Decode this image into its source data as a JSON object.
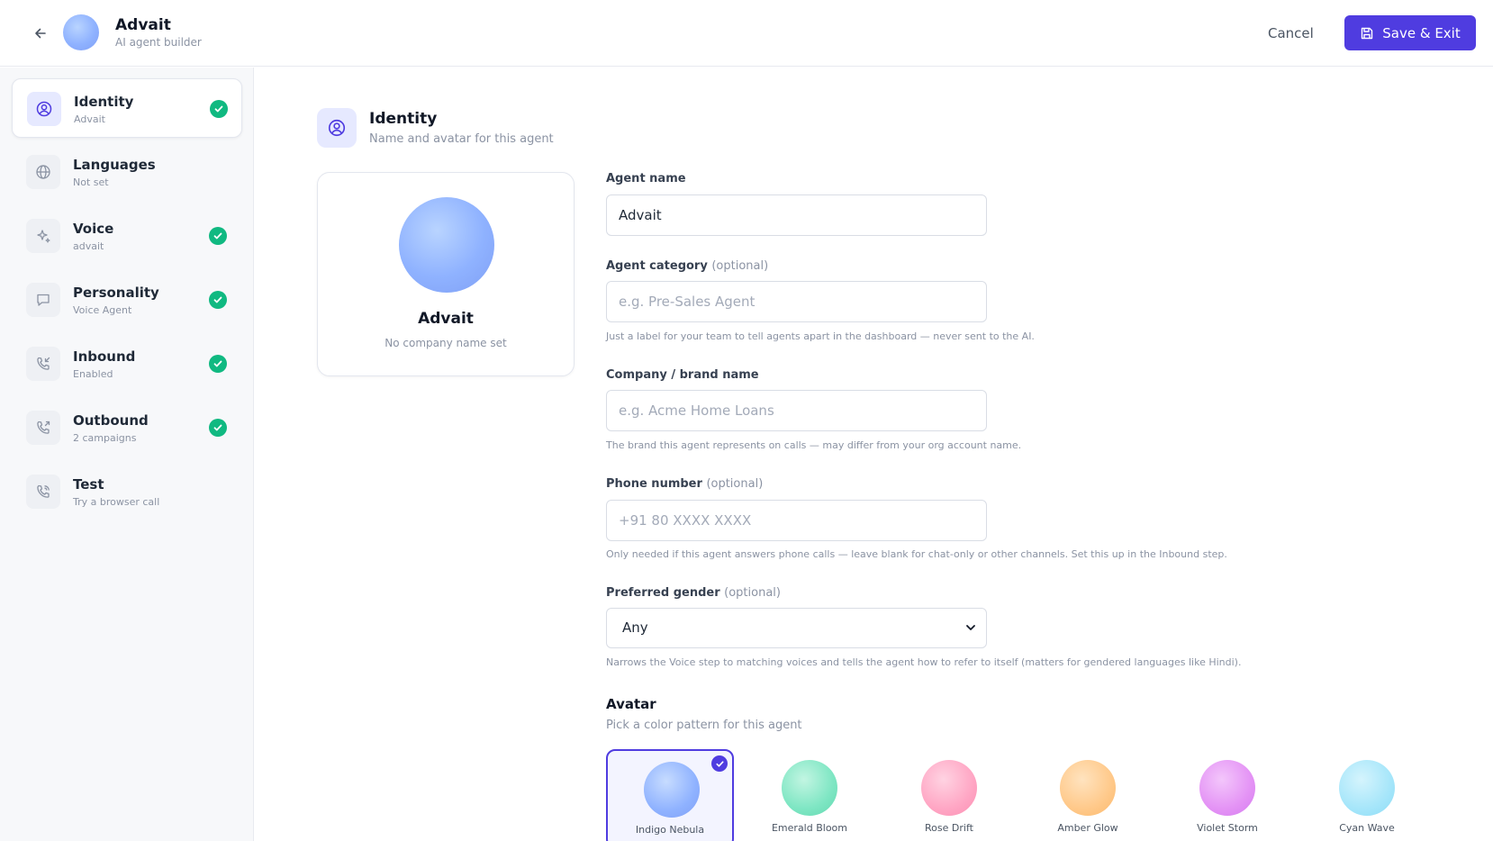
{
  "header": {
    "title": "Advait",
    "subtitle": "AI agent builder",
    "cancel_label": "Cancel",
    "save_label": "Save & Exit",
    "back_icon": "arrow-left-icon",
    "save_icon": "floppy-disk-icon"
  },
  "sidebar": {
    "items": [
      {
        "label": "Identity",
        "sub": "Advait",
        "icon": "user-circle-icon",
        "complete": true,
        "active": true
      },
      {
        "label": "Languages",
        "sub": "Not set",
        "icon": "globe-icon",
        "complete": false,
        "active": false
      },
      {
        "label": "Voice",
        "sub": "advait",
        "icon": "sparkles-icon",
        "complete": true,
        "active": false
      },
      {
        "label": "Personality",
        "sub": "Voice Agent",
        "icon": "chat-bubble-icon",
        "complete": true,
        "active": false
      },
      {
        "label": "Inbound",
        "sub": "Enabled",
        "icon": "phone-incoming-icon",
        "complete": true,
        "active": false
      },
      {
        "label": "Outbound",
        "sub": "2 campaigns",
        "icon": "phone-outgoing-icon",
        "complete": true,
        "active": false
      },
      {
        "label": "Test",
        "sub": "Try a browser call",
        "icon": "phone-call-icon",
        "complete": false,
        "active": false
      }
    ]
  },
  "section": {
    "title": "Identity",
    "subtitle": "Name and avatar for this agent"
  },
  "preview": {
    "name": "Advait",
    "company": "No company name set"
  },
  "form": {
    "agent_name": {
      "label": "Agent name",
      "value": "Advait"
    },
    "agent_category": {
      "label": "Agent category",
      "optional": "(optional)",
      "value": "",
      "placeholder": "e.g. Pre-Sales Agent",
      "help": "Just a label for your team to tell agents apart in the dashboard — never sent to the AI."
    },
    "company": {
      "label": "Company / brand name",
      "value": "",
      "placeholder": "e.g. Acme Home Loans",
      "help": "The brand this agent represents on calls — may differ from your org account name."
    },
    "phone": {
      "label": "Phone number",
      "optional": "(optional)",
      "value": "",
      "placeholder": "+91 80 XXXX XXXX",
      "help": "Only needed if this agent answers phone calls — leave blank for chat-only or other channels. Set this up in the Inbound step."
    },
    "gender": {
      "label": "Preferred gender",
      "optional": "(optional)",
      "value": "Any",
      "help": "Narrows the Voice step to matching voices and tells the agent how to refer to itself (matters for gendered languages like Hindi)."
    }
  },
  "avatar": {
    "title": "Avatar",
    "subtitle": "Pick a color pattern for this agent",
    "selected": "Indigo Nebula",
    "options": [
      {
        "name": "Indigo Nebula",
        "color": "#8fb2ff"
      },
      {
        "name": "Emerald Bloom",
        "color": "#7ee6c3"
      },
      {
        "name": "Rose Drift",
        "color": "#ffa6c4"
      },
      {
        "name": "Amber Glow",
        "color": "#ffc98a"
      },
      {
        "name": "Violet Storm",
        "color": "#e493f5"
      },
      {
        "name": "Cyan Wave",
        "color": "#a6e6fa"
      }
    ]
  },
  "colors": {
    "accent": "#4f3ce0",
    "success": "#10b981"
  }
}
